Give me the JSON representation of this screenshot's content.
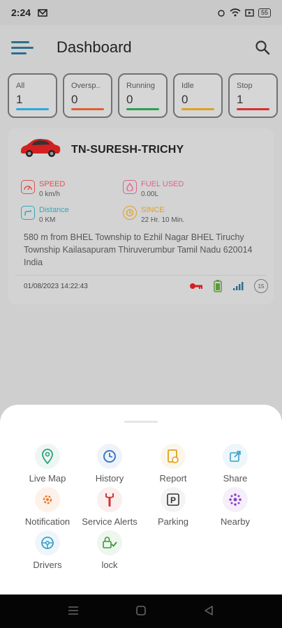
{
  "status_bar": {
    "time": "2:24",
    "battery": "55"
  },
  "header": {
    "title": "Dashboard"
  },
  "tiles": [
    {
      "label": "All",
      "count": "1",
      "color": "#2ea8d8"
    },
    {
      "label": "Oversp..",
      "count": "0",
      "color": "#e06030"
    },
    {
      "label": "Running",
      "count": "0",
      "color": "#2aa050"
    },
    {
      "label": "Idle",
      "count": "0",
      "color": "#e0a020"
    },
    {
      "label": "Stop",
      "count": "1",
      "color": "#d83030"
    }
  ],
  "vehicle": {
    "plate": "TN-SURESH-TRICHY",
    "speed_label": "SPEED",
    "speed_value": "0 km/h",
    "fuel_label": "FUEL USED",
    "fuel_value": "0.00L",
    "distance_label": "Distance",
    "distance_value": "0 KM",
    "since_label": "SINCE",
    "since_value": "22 Hr. 10 Min.",
    "address": "580 m from BHEL Township to Ezhil Nagar BHEL Tiruchy Township Kailasapuram Thiruverumbur Tamil Nadu 620014 India",
    "datetime": "01/08/2023 14:22:43",
    "badge": "15"
  },
  "actions": [
    {
      "label": "Live Map",
      "icon": "map-pin-icon"
    },
    {
      "label": "History",
      "icon": "clock-icon"
    },
    {
      "label": "Report",
      "icon": "report-icon"
    },
    {
      "label": "Share",
      "icon": "share-icon"
    },
    {
      "label": "Notification",
      "icon": "gear-icon"
    },
    {
      "label": "Service Alerts",
      "icon": "wrench-icon"
    },
    {
      "label": "Parking",
      "icon": "parking-icon"
    },
    {
      "label": "Nearby",
      "icon": "nearby-icon"
    },
    {
      "label": "Drivers",
      "icon": "steering-icon"
    },
    {
      "label": "lock",
      "icon": "lock-icon"
    }
  ]
}
